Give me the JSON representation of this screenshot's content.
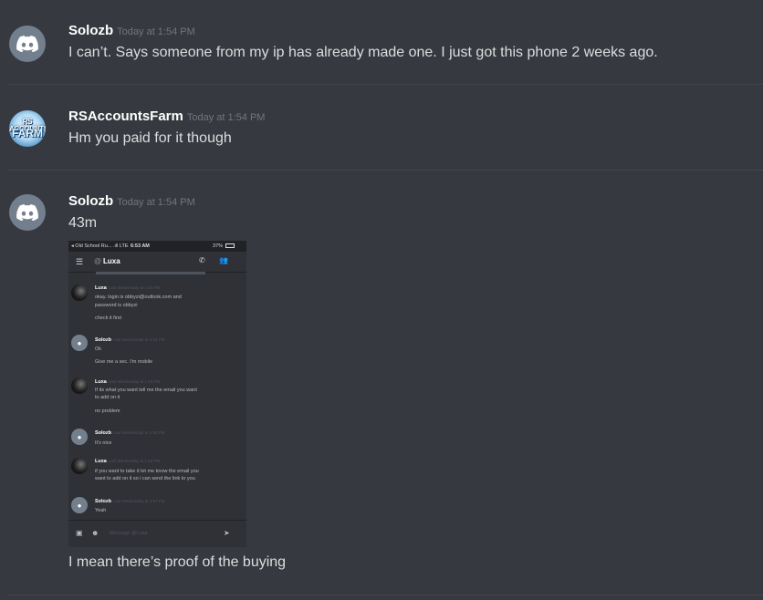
{
  "messages": [
    {
      "username": "Solozb",
      "timestamp": "Today at 1:54 PM",
      "text": "I can’t. Says someone from my ip has already made one. I just got this phone 2 weeks ago.",
      "avatar_icon": "discord-logo-icon"
    },
    {
      "username": "RSAccountsFarm",
      "timestamp": "Today at 1:54 PM",
      "text": "Hm you paid for it though",
      "avatar_lines": [
        "RS ACCOUNTS",
        "FARM"
      ]
    },
    {
      "username": "Solozb",
      "timestamp": "Today at 1:54 PM",
      "text": "43m",
      "text_after_image": "I mean there’s proof of the buying",
      "avatar_icon": "discord-logo-icon"
    }
  ],
  "screenshot": {
    "status_bar": {
      "left": "◂ Old School Ru... .ıll LTE",
      "time": "6:53 AM",
      "battery": "37%"
    },
    "channel": "Luxa",
    "messages": [
      {
        "user": "Luxa",
        "ts": "Last Wednesday at 1:54 PM",
        "lines": [
          "okay. login is obbyzi@outlook.com and",
          "password is obbyzi",
          "check it first"
        ]
      },
      {
        "user": "Solozb",
        "ts": "Last Wednesday at 1:54 PM",
        "lines": [
          "Ok",
          "Give me a sec. I'm mobile"
        ]
      },
      {
        "user": "Luxa",
        "ts": "Last Wednesday at 1:56 PM",
        "lines": [
          "If its what you want tell me the email you want",
          "to add on it",
          "no problem"
        ]
      },
      {
        "user": "Solozb",
        "ts": "Last Wednesday at 1:56 PM",
        "lines": [
          "It's nice"
        ]
      },
      {
        "user": "Luxa",
        "ts": "Last Wednesday at 1:56 PM",
        "lines": [
          "if you want to take it let me know the email you",
          "want to add on it so i can send the link to you"
        ]
      },
      {
        "user": "Solozb",
        "ts": "Last Wednesday at 1:57 PM",
        "lines": [
          "Yeah"
        ]
      }
    ],
    "input_placeholder": "Message @Luxa"
  },
  "colors": {
    "background": "#36393f",
    "username": "#ffffff",
    "timestamp": "#72767d",
    "text": "#dcddde",
    "avatar_blurple_gray": "#747f8d"
  }
}
